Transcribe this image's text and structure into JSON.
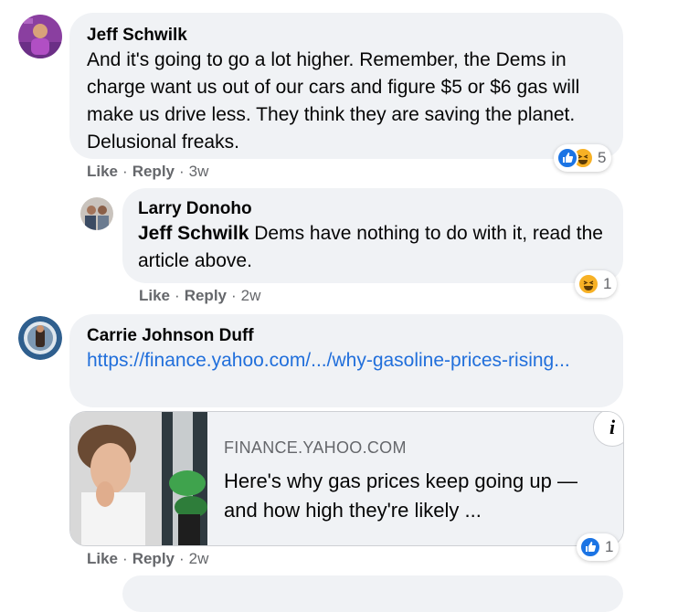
{
  "comments": [
    {
      "author": "Jeff Schwilk",
      "text": "And it's going to go a lot higher. Remember, the Dems in charge want us out of our cars and figure $5 or $6 gas will make us drive less. They think they are saving the planet. Delusional freaks.",
      "reactions": {
        "icons": [
          "like-icon",
          "haha-icon"
        ],
        "count": "5"
      },
      "actions": {
        "like": "Like",
        "reply": "Reply",
        "time": "3w"
      },
      "replies": [
        {
          "author": "Larry Donoho",
          "mention": "Jeff Schwilk",
          "text": " Dems have nothing to do with it, read the article above.",
          "reactions": {
            "icons": [
              "haha-icon"
            ],
            "count": "1"
          },
          "actions": {
            "like": "Like",
            "reply": "Reply",
            "time": "2w"
          }
        }
      ]
    },
    {
      "author": "Carrie Johnson Duff",
      "link_text": "https://finance.yahoo.com/.../why-gasoline-prices-rising...",
      "preview": {
        "domain": "FINANCE.YAHOO.COM",
        "title": "Here's why gas prices keep going up — and how high they're likely ..."
      },
      "reactions": {
        "icons": [
          "like-icon"
        ],
        "count": "1"
      },
      "actions": {
        "like": "Like",
        "reply": "Reply",
        "time": "2w"
      }
    }
  ],
  "colors": {
    "bubble": "#f0f2f5",
    "link": "#216fdb",
    "meta": "#65676b",
    "like_blue": "#1b74e4",
    "haha_yellow": "#f7b125"
  },
  "separator": "·"
}
